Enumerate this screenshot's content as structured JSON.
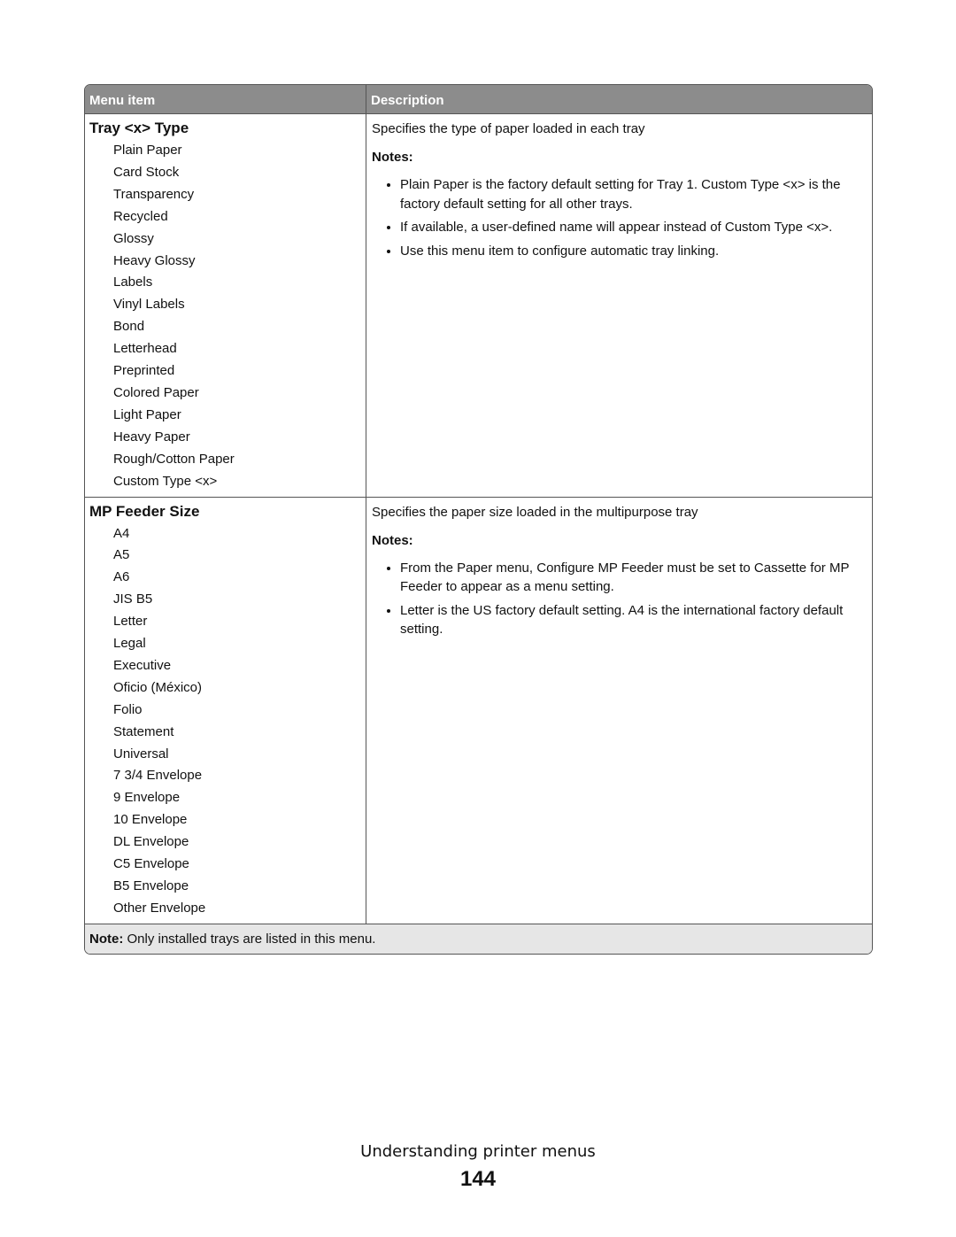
{
  "table": {
    "headers": {
      "menu_item": "Menu item",
      "description": "Description"
    },
    "rows": [
      {
        "title": "Tray <x> Type",
        "options": [
          "Plain Paper",
          "Card Stock",
          "Transparency",
          "Recycled",
          "Glossy",
          "Heavy Glossy",
          "Labels",
          "Vinyl Labels",
          "Bond",
          "Letterhead",
          "Preprinted",
          "Colored Paper",
          "Light Paper",
          "Heavy Paper",
          "Rough/Cotton Paper",
          "Custom Type <x>"
        ],
        "description": "Specifies the type of paper loaded in each tray",
        "notes_label": "Notes:",
        "notes": [
          "Plain Paper is the factory default setting for Tray 1. Custom Type <x> is the factory default setting for all other trays.",
          "If available, a user-defined name will appear instead of Custom Type <x>.",
          "Use this menu item to configure automatic tray linking."
        ]
      },
      {
        "title": "MP Feeder Size",
        "options": [
          "A4",
          "A5",
          "A6",
          "JIS B5",
          "Letter",
          "Legal",
          "Executive",
          "Oficio (México)",
          "Folio",
          "Statement",
          "Universal",
          "7 3/4 Envelope",
          "9 Envelope",
          "10 Envelope",
          "DL Envelope",
          "C5 Envelope",
          "B5 Envelope",
          "Other Envelope"
        ],
        "description": "Specifies the paper size loaded in the multipurpose tray",
        "notes_label": "Notes:",
        "notes": [
          "From the Paper menu, Configure MP Feeder must be set to Cassette for MP Feeder to appear as a menu setting.",
          "Letter is the US factory default setting. A4 is the international factory default setting."
        ]
      }
    ],
    "footer_note_label": "Note:",
    "footer_note_text": " Only installed trays are listed in this menu."
  },
  "page_footer": {
    "section_title": "Understanding printer menus",
    "page_number": "144"
  },
  "colors": {
    "header_bg": "#8c8c8c",
    "footer_bg": "#e6e6e6",
    "border": "#555555"
  }
}
